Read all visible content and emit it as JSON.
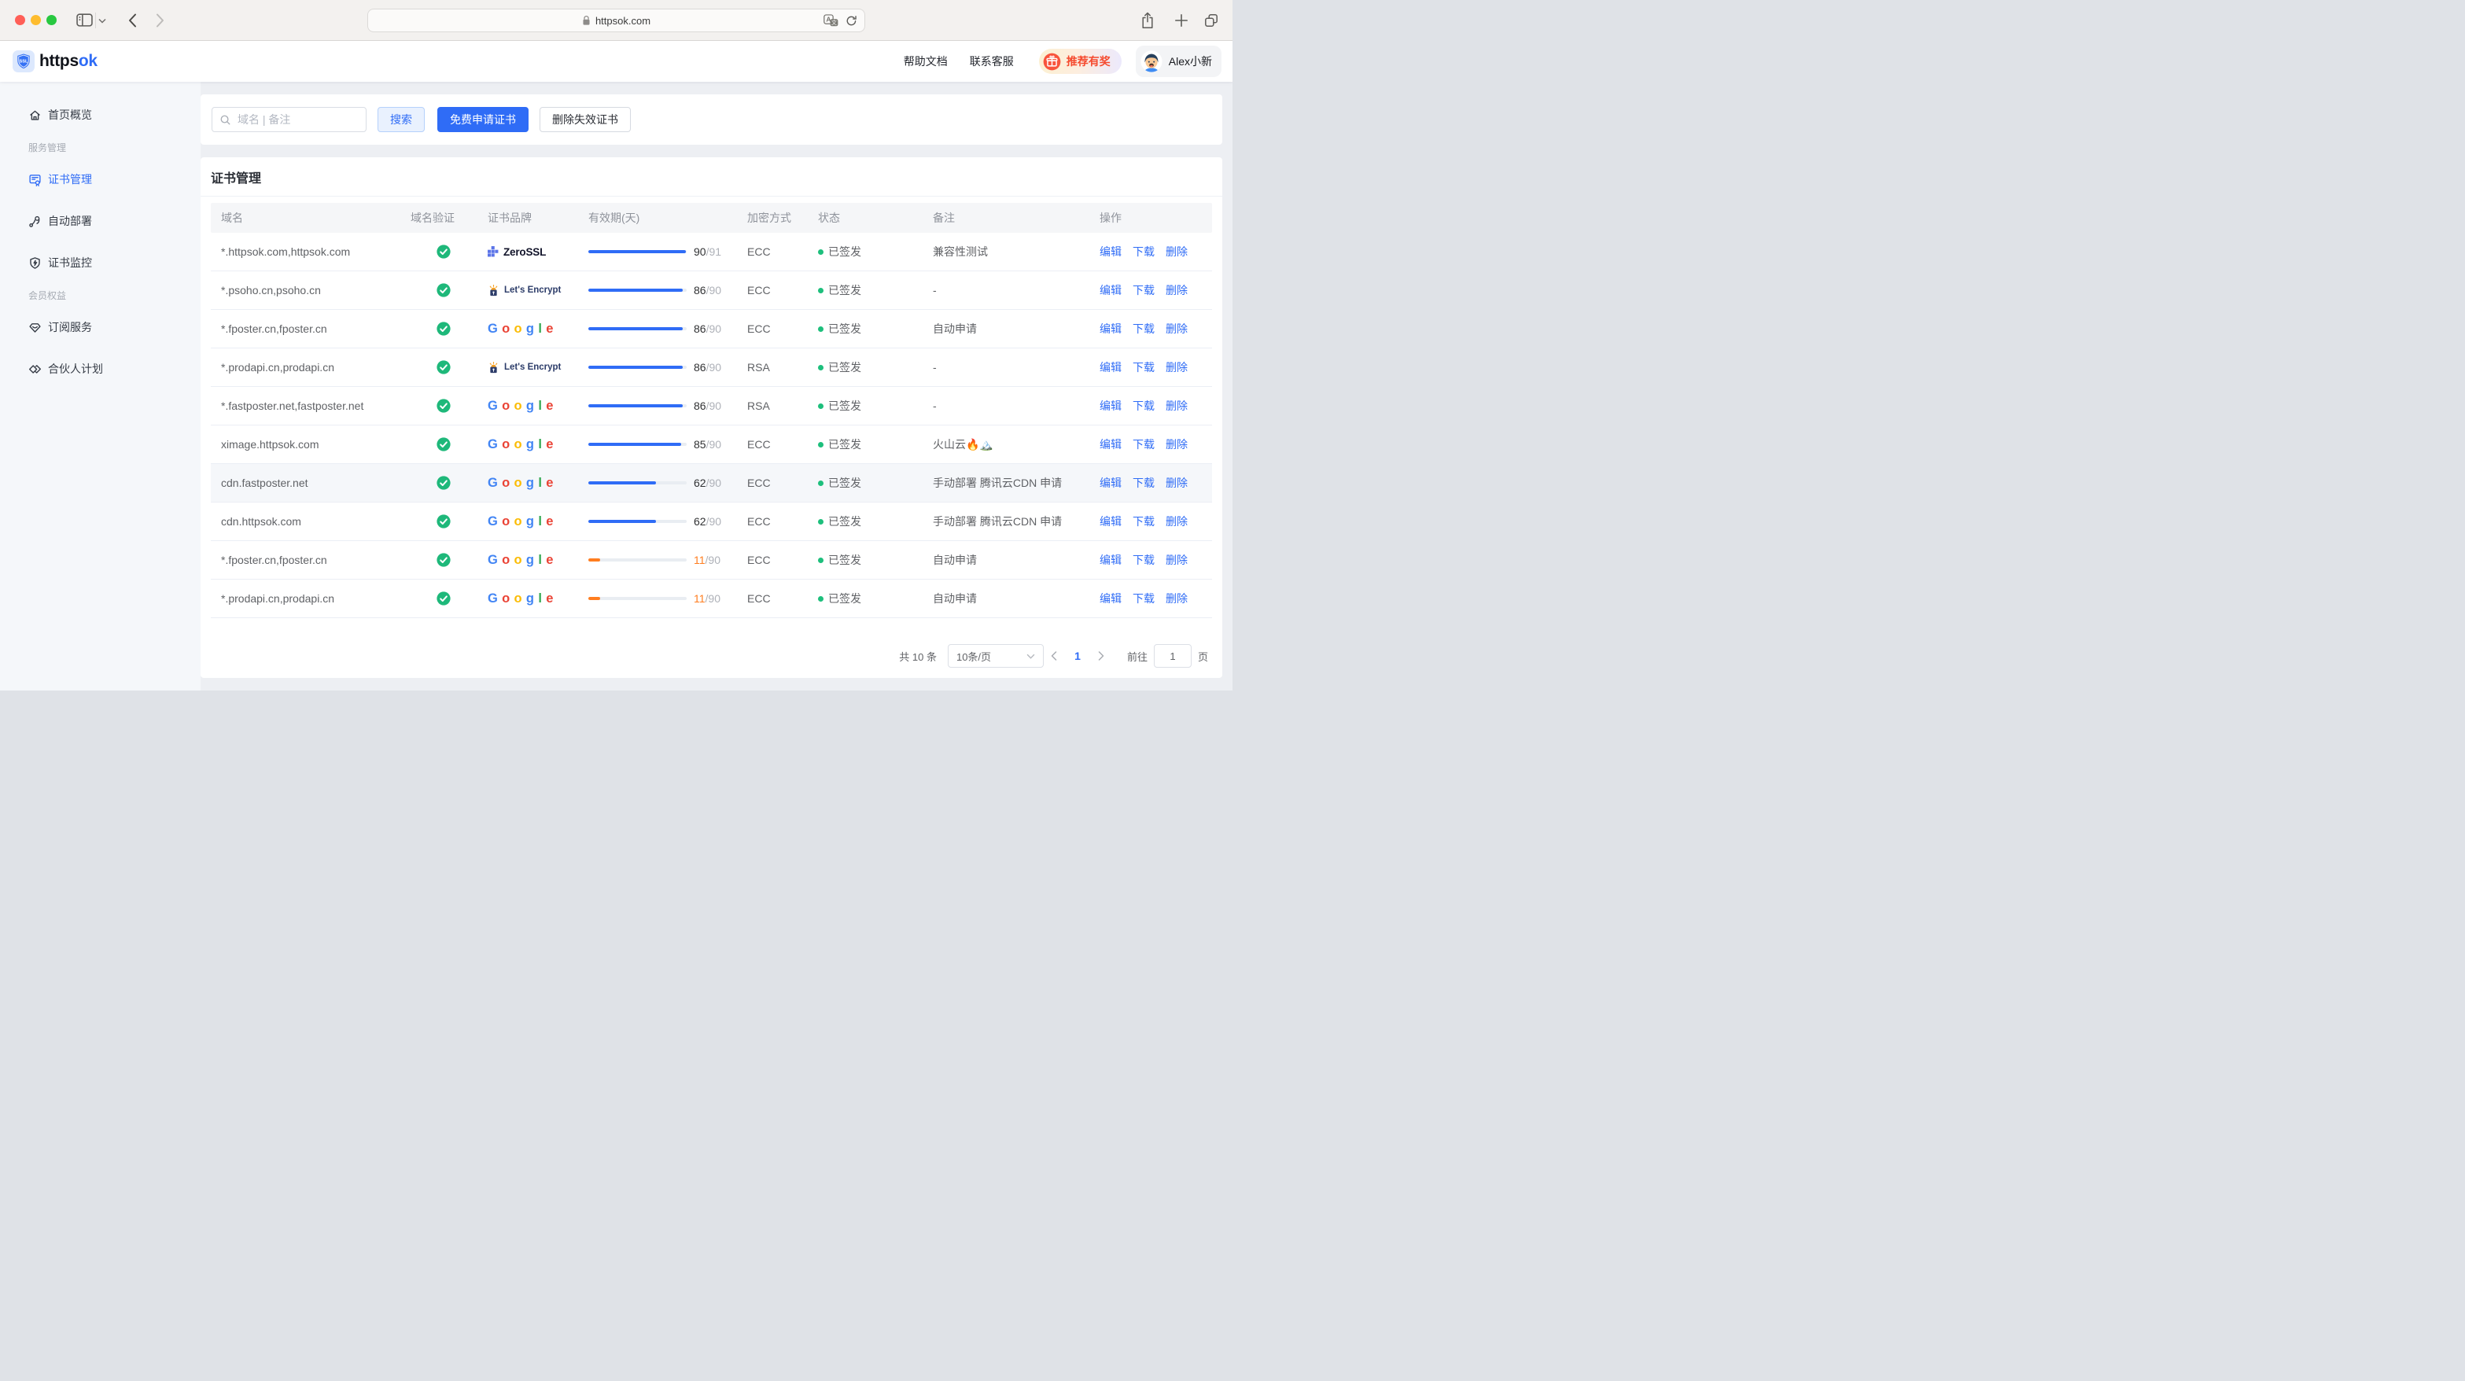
{
  "browser": {
    "url": "httpsok.com"
  },
  "header": {
    "brand_prefix": "https",
    "brand_suffix": "ok",
    "logo_text": "SSL",
    "nav": [
      {
        "label": "帮助文档"
      },
      {
        "label": "联系客服"
      }
    ],
    "promo_label": "推荐有奖",
    "user_name": "Alex小新"
  },
  "sidebar": {
    "items": [
      {
        "type": "item",
        "icon": "home",
        "label": "首页概览"
      },
      {
        "type": "section",
        "label": "服务管理"
      },
      {
        "type": "item",
        "icon": "certificate",
        "label": "证书管理",
        "active": true
      },
      {
        "type": "item",
        "icon": "deploy",
        "label": "自动部署"
      },
      {
        "type": "item",
        "icon": "monitor",
        "label": "证书监控"
      },
      {
        "type": "section",
        "label": "会员权益"
      },
      {
        "type": "item",
        "icon": "subscribe",
        "label": "订阅服务"
      },
      {
        "type": "item",
        "icon": "partner",
        "label": "合伙人计划"
      }
    ]
  },
  "toolbar": {
    "search_placeholder": "域名 | 备注",
    "search_button": "搜索",
    "apply_button": "免费申请证书",
    "delete_button": "删除失效证书"
  },
  "table": {
    "title": "证书管理",
    "columns": [
      "域名",
      "域名验证",
      "证书品牌",
      "有效期(天)",
      "加密方式",
      "状态",
      "备注",
      "操作"
    ],
    "brands": {
      "zerossl": "ZeroSSL",
      "letsencrypt": "Let's Encrypt",
      "google": "Google"
    },
    "brand_colors": {
      "zerossl_icon": "#5b74e8",
      "zerossl_text": "#13152b",
      "letsencrypt_text": "#2c3c69",
      "google_letters": [
        "#4285F4",
        "#EA4335",
        "#FBBC05",
        "#4285F4",
        "#34A853",
        "#EA4335"
      ]
    },
    "status_color": "#1dbf7c",
    "bar_colors": {
      "ok": "#2f6cf6",
      "warn": "#ff7d1f"
    },
    "actions": [
      "编辑",
      "下载",
      "删除"
    ],
    "action_names": [
      "edit",
      "download",
      "delete"
    ],
    "rows": [
      {
        "domain": "*.httpsok.com,httpsok.com",
        "verified": true,
        "brand": "zerossl",
        "days": 90,
        "total": 91,
        "level": "ok",
        "encryption": "ECC",
        "status": "已签发",
        "remark": "兼容性测试",
        "highlighted": false
      },
      {
        "domain": "*.psoho.cn,psoho.cn",
        "verified": true,
        "brand": "letsencrypt",
        "days": 86,
        "total": 90,
        "level": "ok",
        "encryption": "ECC",
        "status": "已签发",
        "remark": "-",
        "highlighted": false
      },
      {
        "domain": "*.fposter.cn,fposter.cn",
        "verified": true,
        "brand": "google",
        "days": 86,
        "total": 90,
        "level": "ok",
        "encryption": "ECC",
        "status": "已签发",
        "remark": "自动申请",
        "highlighted": false
      },
      {
        "domain": "*.prodapi.cn,prodapi.cn",
        "verified": true,
        "brand": "letsencrypt",
        "days": 86,
        "total": 90,
        "level": "ok",
        "encryption": "RSA",
        "status": "已签发",
        "remark": "-",
        "highlighted": false
      },
      {
        "domain": "*.fastposter.net,fastposter.net",
        "verified": true,
        "brand": "google",
        "days": 86,
        "total": 90,
        "level": "ok",
        "encryption": "RSA",
        "status": "已签发",
        "remark": "-",
        "highlighted": false
      },
      {
        "domain": "ximage.httpsok.com",
        "verified": true,
        "brand": "google",
        "days": 85,
        "total": 90,
        "level": "ok",
        "encryption": "ECC",
        "status": "已签发",
        "remark": "火山云🔥🏔️",
        "highlighted": false
      },
      {
        "domain": "cdn.fastposter.net",
        "verified": true,
        "brand": "google",
        "days": 62,
        "total": 90,
        "level": "ok",
        "encryption": "ECC",
        "status": "已签发",
        "remark": "手动部署 腾讯云CDN 申请",
        "highlighted": true
      },
      {
        "domain": "cdn.httpsok.com",
        "verified": true,
        "brand": "google",
        "days": 62,
        "total": 90,
        "level": "ok",
        "encryption": "ECC",
        "status": "已签发",
        "remark": "手动部署 腾讯云CDN 申请",
        "highlighted": false
      },
      {
        "domain": "*.fposter.cn,fposter.cn",
        "verified": true,
        "brand": "google",
        "days": 11,
        "total": 90,
        "level": "warn",
        "encryption": "ECC",
        "status": "已签发",
        "remark": "自动申请",
        "highlighted": false
      },
      {
        "domain": "*.prodapi.cn,prodapi.cn",
        "verified": true,
        "brand": "google",
        "days": 11,
        "total": 90,
        "level": "warn",
        "encryption": "ECC",
        "status": "已签发",
        "remark": "自动申请",
        "highlighted": false
      }
    ]
  },
  "pagination": {
    "total_label": "共 10 条",
    "page_size": "10条/页",
    "current_page": "1",
    "goto_label": "前往",
    "goto_value": "1",
    "unit_label": "页"
  },
  "icons": {
    "traffic_lights": [
      "#ff5f57",
      "#febc2e",
      "#28c840"
    ],
    "names": [
      "sidebar-toggle-icon",
      "chevron-down-icon",
      "back-icon",
      "forward-icon",
      "lock-icon",
      "translate-icon",
      "reload-icon",
      "share-icon",
      "new-tab-icon",
      "tab-overview-icon",
      "search-icon",
      "gift-icon",
      "verified-check-icon",
      "status-dot"
    ]
  }
}
